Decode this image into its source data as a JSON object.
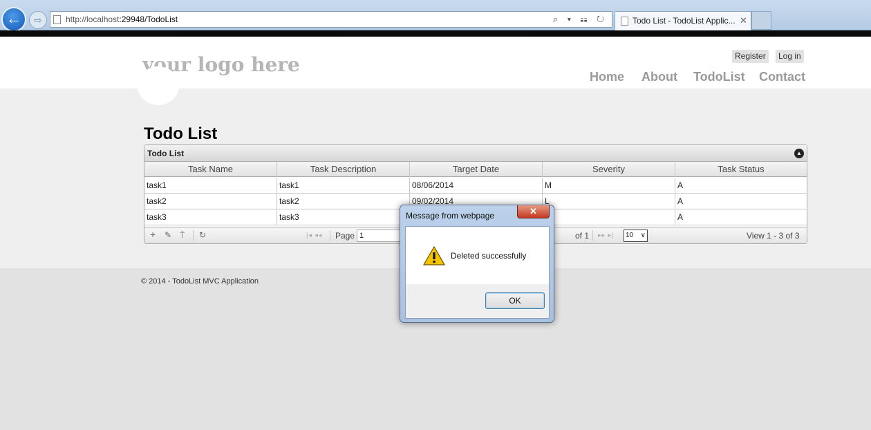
{
  "browser": {
    "url_host": "http://localhost",
    "url_path": ":29948/TodoList",
    "tab_title": "Todo List - TodoList Applic...",
    "back_glyph": "←",
    "forward_glyph": "⇨",
    "address_tools": "⌕ ▾ ☷ ↻",
    "tab_close_glyph": "✕"
  },
  "header": {
    "logo": "your logo here",
    "register": "Register",
    "login": "Log in",
    "nav": [
      "Home",
      "About",
      "TodoList",
      "Contact"
    ]
  },
  "main": {
    "title": "Todo List"
  },
  "grid": {
    "caption": "Todo List",
    "collapse_glyph": "▲",
    "columns": [
      "Task Name",
      "Task Description",
      "Target Date",
      "Severity",
      "Task Status"
    ],
    "rows": [
      [
        "task1",
        "task1",
        "08/06/2014",
        "M",
        "A"
      ],
      [
        "task2",
        "task2",
        "09/02/2014",
        "L",
        "A"
      ],
      [
        "task3",
        "task3",
        "",
        "",
        "A"
      ]
    ],
    "pager": {
      "add_glyph": "+",
      "edit_glyph": "✎",
      "delete_glyph": "⍑",
      "refresh_glyph": "↻",
      "first_prev_glyph": "|◂ ◂◂",
      "next_last_glyph": "▸▸ ▸|",
      "page_label": "Page",
      "page_value": "1",
      "of_label": "of 1",
      "rows_per_page": "10",
      "select_chevron": "∨",
      "view_label": "View 1 - 3 of 3"
    }
  },
  "footer": {
    "text": "© 2014 - TodoList MVC Application"
  },
  "dialog": {
    "title": "Message from webpage",
    "close_glyph": "✕",
    "message": "Deleted successfully",
    "ok": "OK",
    "icon": "warning-icon"
  },
  "colors": {
    "accent_blue": "#1458b8",
    "page_bg": "#efefef",
    "dialog_frame": "#bcd1ea",
    "close_red": "#c33a20"
  }
}
